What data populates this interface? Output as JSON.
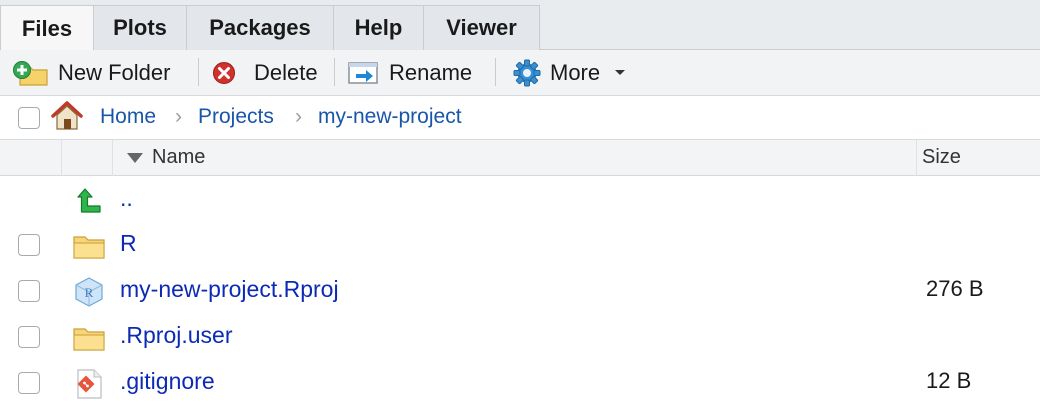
{
  "tabs": [
    {
      "label": "Files",
      "active": true
    },
    {
      "label": "Plots",
      "active": false
    },
    {
      "label": "Packages",
      "active": false
    },
    {
      "label": "Help",
      "active": false
    },
    {
      "label": "Viewer",
      "active": false
    }
  ],
  "toolbar": {
    "new_folder_label": "New Folder",
    "delete_label": "Delete",
    "rename_label": "Rename",
    "more_label": "More"
  },
  "breadcrumb": [
    "Home",
    "Projects",
    "my-new-project"
  ],
  "columns": {
    "name": "Name",
    "size": "Size",
    "sort": "descending"
  },
  "files": [
    {
      "name": "..",
      "size": "",
      "icon": "parent-dir-icon"
    },
    {
      "name": "R",
      "size": "",
      "icon": "folder-icon"
    },
    {
      "name": "my-new-project.Rproj",
      "size": "276 B",
      "icon": "rproj-file-icon"
    },
    {
      "name": ".Rproj.user",
      "size": "",
      "icon": "folder-icon"
    },
    {
      "name": ".gitignore",
      "size": "12 B",
      "icon": "git-file-icon"
    }
  ],
  "colors": {
    "link": "#1a56a8",
    "file_link": "#0d2ab5",
    "tab_bg": "#e9ecef",
    "toolbar_bg": "#f1f3f5"
  }
}
